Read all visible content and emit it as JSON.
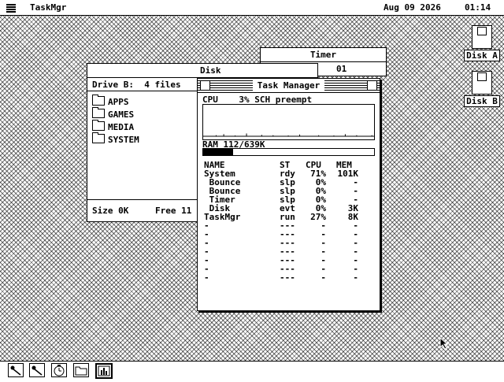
{
  "menubar": {
    "app_name": "TaskMgr",
    "date": "Aug 09 2026",
    "time": "01:14"
  },
  "desktop_icons": [
    {
      "label": "Disk A"
    },
    {
      "label": "Disk B"
    }
  ],
  "timer_window": {
    "title": "Timer",
    "peek_text": "01"
  },
  "disk_window": {
    "title": "Disk",
    "header": "Drive B:  4 files",
    "folders": [
      "APPS",
      "GAMES",
      "MEDIA",
      "SYSTEM"
    ],
    "footer_size": "Size 0K",
    "footer_free": "Free 11"
  },
  "task_manager": {
    "title": "Task Manager",
    "cpu_line": "CPU    3% SCH preempt",
    "cpu_history_percent": [
      0,
      0,
      0,
      3,
      0,
      6,
      0,
      0,
      2,
      0,
      0,
      8,
      0,
      0,
      0,
      4,
      0,
      0,
      3,
      0,
      0,
      0,
      2,
      0,
      0,
      5,
      0,
      0,
      0,
      0,
      3,
      0,
      0,
      0,
      2,
      0,
      0,
      6,
      0,
      0,
      3,
      0,
      0,
      0,
      3
    ],
    "ram_line": "RAM 112/639K",
    "ram_used_k": 112,
    "ram_total_k": 639,
    "columns": [
      "NAME",
      "ST",
      "CPU",
      "MEM"
    ],
    "rows": [
      {
        "name": "System",
        "st": "rdy",
        "cpu": "71%",
        "mem": "101K"
      },
      {
        "name": " Bounce",
        "st": "slp",
        "cpu": "0%",
        "mem": "-"
      },
      {
        "name": " Bounce",
        "st": "slp",
        "cpu": "0%",
        "mem": "-"
      },
      {
        "name": " Timer",
        "st": "slp",
        "cpu": "0%",
        "mem": "-"
      },
      {
        "name": " Disk",
        "st": "evt",
        "cpu": "0%",
        "mem": "3K"
      },
      {
        "name": "TaskMgr",
        "st": "run",
        "cpu": "27%",
        "mem": "8K"
      },
      {
        "name": "-",
        "st": "---",
        "cpu": "-",
        "mem": "-"
      },
      {
        "name": "-",
        "st": "---",
        "cpu": "-",
        "mem": "-"
      },
      {
        "name": "-",
        "st": "---",
        "cpu": "-",
        "mem": "-"
      },
      {
        "name": "-",
        "st": "---",
        "cpu": "-",
        "mem": "-"
      },
      {
        "name": "-",
        "st": "---",
        "cpu": "-",
        "mem": "-"
      },
      {
        "name": "-",
        "st": "---",
        "cpu": "-",
        "mem": "-"
      },
      {
        "name": "-",
        "st": "---",
        "cpu": "-",
        "mem": "-"
      }
    ]
  },
  "taskbar": {
    "icons": [
      "bounce-icon",
      "bounce-icon",
      "timer-icon",
      "disk-folder-icon",
      "taskmgr-icon"
    ],
    "selected_index": 4
  }
}
